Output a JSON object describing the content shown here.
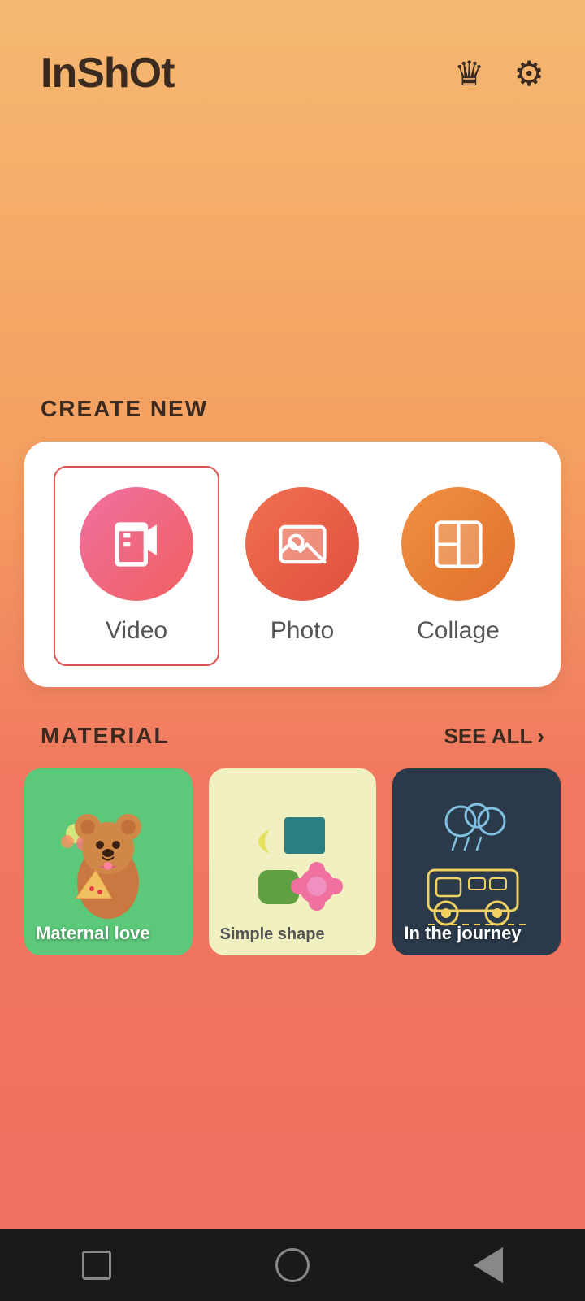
{
  "app": {
    "title": "InShOt"
  },
  "header": {
    "crown_icon": "crown",
    "settings_icon": "gear"
  },
  "create_new": {
    "section_label": "CREATE NEW",
    "items": [
      {
        "id": "video",
        "label": "Video",
        "selected": true
      },
      {
        "id": "photo",
        "label": "Photo",
        "selected": false
      },
      {
        "id": "collage",
        "label": "Collage",
        "selected": false
      }
    ]
  },
  "material": {
    "section_label": "MATERIAL",
    "see_all_label": "SEE ALL",
    "items": [
      {
        "id": "maternal-love",
        "label": "Maternal love",
        "bg": "green"
      },
      {
        "id": "simple-shape",
        "label": "Simple shape",
        "bg": "yellow"
      },
      {
        "id": "in-the-journey",
        "label": "In the journey",
        "bg": "dark"
      }
    ]
  },
  "bottom_nav": {
    "square_label": "recent apps",
    "circle_label": "home",
    "triangle_label": "back"
  }
}
